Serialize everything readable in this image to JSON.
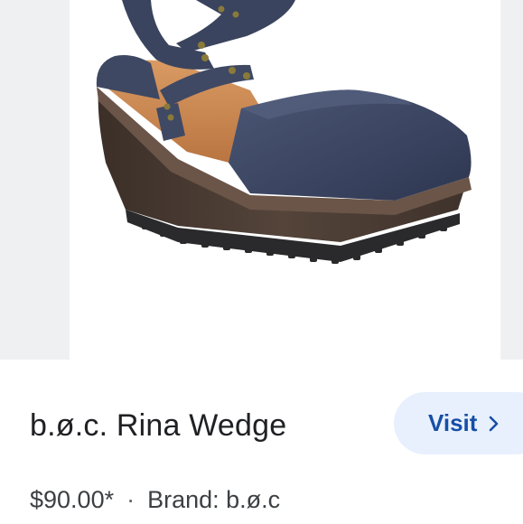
{
  "product": {
    "title": "b.ø.c. Rina Wedge",
    "price": "$90.00*",
    "separator": "·",
    "brand_text": "Brand: b.ø.c",
    "image_alt": "Navy suede wedge clog sandal with ankle strap"
  },
  "actions": {
    "visit_label": "Visit",
    "visit_icon": "chevron-right-icon"
  },
  "colors": {
    "accent": "#174ea6",
    "button_bg": "#e8f0fe",
    "text_primary": "#202124",
    "shoe_suede": "#3d4760",
    "wedge": "#4a3a30"
  }
}
